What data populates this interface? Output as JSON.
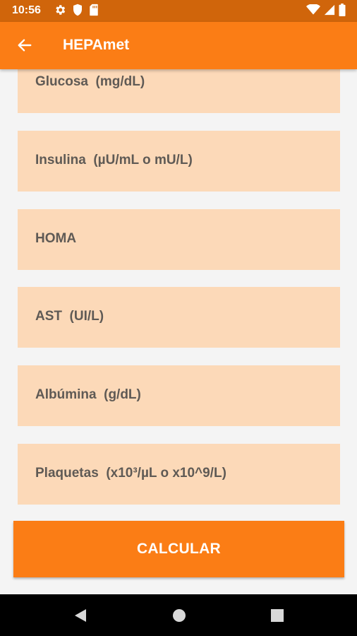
{
  "status_bar": {
    "time": "10:56",
    "icons": [
      "gear-icon",
      "shield-icon",
      "sd-card-icon",
      "wifi-icon",
      "signal-icon",
      "battery-icon"
    ]
  },
  "app_bar": {
    "title": "HEPAmet",
    "back_icon": "arrow-left-icon",
    "color": "#fb7d15"
  },
  "fields": [
    {
      "label": "Glucosa  (mg/dL)"
    },
    {
      "label": "Insulina  (µU/mL o mU/L)"
    },
    {
      "label": "HOMA"
    },
    {
      "label": "AST  (UI/L)"
    },
    {
      "label": "Albúmina  (g/dL)"
    },
    {
      "label": "Plaquetas  (x10³/µL o x10^9/L)"
    }
  ],
  "calculate_button": {
    "label": "CALCULAR"
  },
  "nav_bar": {
    "icons": [
      "back-triangle-icon",
      "home-circle-icon",
      "recents-square-icon"
    ]
  },
  "colors": {
    "status_bar": "#d0650b",
    "accent": "#fb7d15",
    "field_bg": "#fcd9b8",
    "label_text": "#5f5a55",
    "page_bg": "#f4f4f4"
  }
}
